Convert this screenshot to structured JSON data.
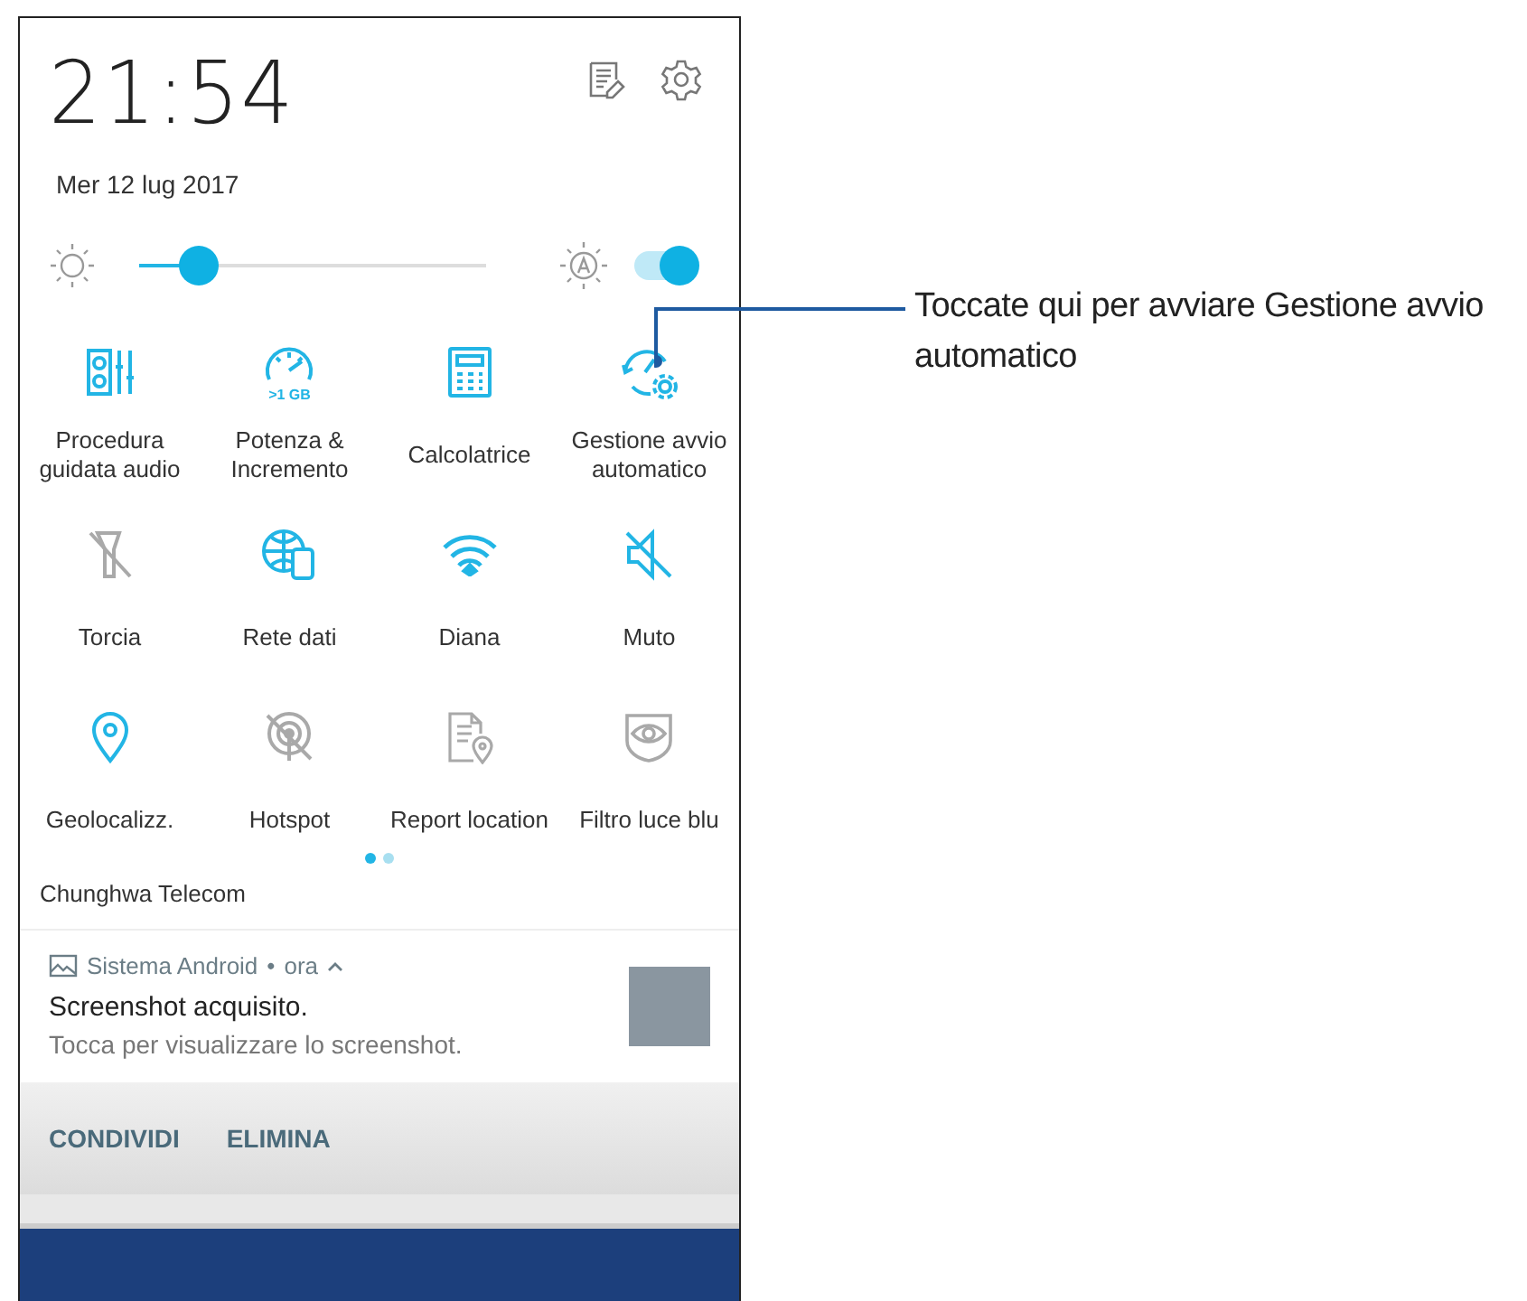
{
  "clock": {
    "time": "21:54",
    "date": "Mer 12 lug 2017"
  },
  "brightness": {
    "level": 0.17,
    "auto": true
  },
  "tiles": [
    {
      "kind": "audio",
      "label": "Procedura guidata audio",
      "on": true
    },
    {
      "kind": "boost",
      "label": "Potenza & Incremento",
      "badge": ">1 GB",
      "on": true
    },
    {
      "kind": "calculator",
      "label": "Calcolatrice",
      "on": true
    },
    {
      "kind": "autostart",
      "label": "Gestione avvio automatico",
      "on": true
    },
    {
      "kind": "flashlight",
      "label": "Torcia",
      "on": false
    },
    {
      "kind": "data",
      "label": "Rete dati",
      "on": true
    },
    {
      "kind": "wifi",
      "label": "Diana",
      "on": true
    },
    {
      "kind": "mute",
      "label": "Muto",
      "on": true
    },
    {
      "kind": "location",
      "label": "Geolocalizz.",
      "on": true
    },
    {
      "kind": "hotspot",
      "label": "Hotspot",
      "on": false
    },
    {
      "kind": "report",
      "label": "Report location",
      "on": false
    },
    {
      "kind": "bluelight",
      "label": "Filtro luce blu",
      "on": false
    }
  ],
  "pages": [
    {
      "selected": true
    },
    {
      "selected": false
    }
  ],
  "carrier": "Chunghwa Telecom",
  "notification": {
    "app": "Sistema Android",
    "separator": "•",
    "time": "ora",
    "title": "Screenshot acquisito.",
    "body": "Tocca per visualizzare lo screenshot.",
    "actions": [
      "CONDIVIDI",
      "ELIMINA"
    ]
  },
  "callout": "Toccate qui per avviare Gestione avvio automatico"
}
